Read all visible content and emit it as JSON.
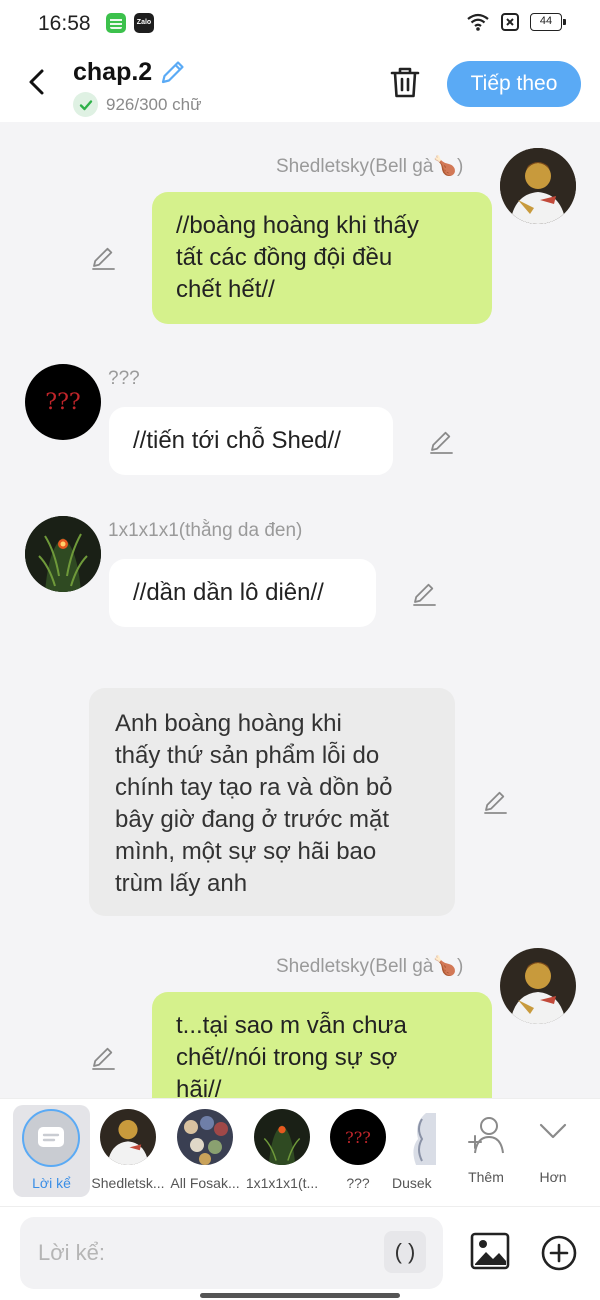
{
  "status_bar": {
    "time": "16:58",
    "battery": "44",
    "apps": [
      "app-icon",
      "zalo-icon"
    ],
    "zalo_label": "Zalo"
  },
  "header": {
    "title": "chap.2",
    "word_count": "926/300 chữ",
    "next_label": "Tiếp theo"
  },
  "messages": [
    {
      "type": "character",
      "side": "right",
      "sender": "Shedletsky(Bell gà🍗)",
      "text": [
        "//boàng hoàng khi thấy",
        "tất các đồng đội đều",
        "chết hết//"
      ],
      "bubble_color": "#d5f18c"
    },
    {
      "type": "character",
      "side": "left",
      "sender": "???",
      "avatar_text": "???",
      "text": [
        "//tiến tới chỗ Shed//"
      ],
      "bubble_color": "#ffffff"
    },
    {
      "type": "character",
      "side": "left",
      "sender": "1x1x1x1(thằng da đen)",
      "text": [
        "//dần dần lô diên//"
      ],
      "bubble_color": "#ffffff"
    },
    {
      "type": "narration",
      "text": [
        "Anh boàng hoàng khi",
        "thấy thứ sản phẩm lỗi do",
        "chính tay tạo ra và dồn bỏ",
        "bây giờ đang ở trước mặt",
        "mình, một sự sợ hãi bao",
        "trùm lấy anh"
      ],
      "bubble_color": "#ebebeb"
    },
    {
      "type": "character",
      "side": "right",
      "sender": "Shedletsky(Bell gà🍗)",
      "text": [
        "t...tại sao m vẫn chưa",
        "chết//nói trong sự sợ",
        "hãi//"
      ],
      "bubble_color": "#d5f18c"
    }
  ],
  "characters": [
    {
      "label": "Lời kể",
      "selected": true
    },
    {
      "label": "Shedletsk..."
    },
    {
      "label": "All Fosak..."
    },
    {
      "label": "1x1x1x1(t..."
    },
    {
      "label": "???",
      "avatar_text": "???"
    },
    {
      "label": "Dusek"
    }
  ],
  "tools": {
    "more_label": "Thêm",
    "collapse_label": "Hơn"
  },
  "input": {
    "placeholder": "Lời kể:",
    "paren_label": "( )"
  },
  "colors": {
    "accent": "#5aaaf5",
    "user_bubble": "#d5f18c",
    "narration_bubble": "#ebebeb"
  }
}
